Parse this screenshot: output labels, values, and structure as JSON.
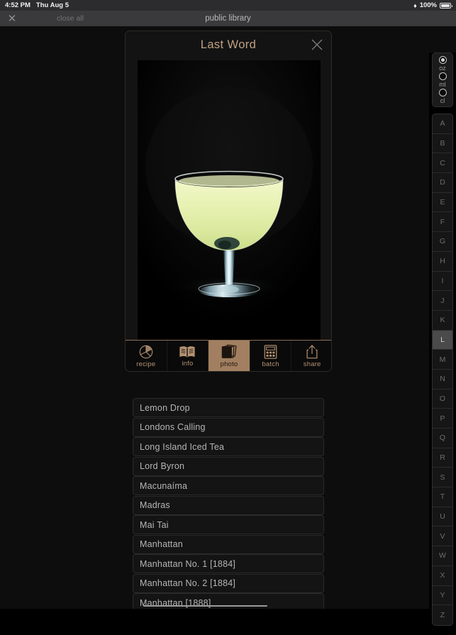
{
  "status_bar": {
    "time": "4:52 PM",
    "date": "Thu Aug 5",
    "wifi_icon": "wifi-icon",
    "battery_percent": "100%",
    "battery_icon": "battery-full-icon"
  },
  "browser_bar": {
    "close_icon": "close-x-icon",
    "close_all_label": "close all",
    "title": "public library"
  },
  "card": {
    "title": "Last Word",
    "close_icon": "close-x-icon",
    "photo": {
      "subject": "coupe cocktail glass",
      "drink_color": "#e4efb0",
      "background_color": "#000000"
    },
    "tabs": [
      {
        "label": "recipe",
        "icon": "pie-chart-icon",
        "active": false
      },
      {
        "label": "info",
        "icon": "open-book-icon",
        "active": false
      },
      {
        "label": "photo",
        "icon": "photo-stack-icon",
        "active": true
      },
      {
        "label": "batch",
        "icon": "calculator-icon",
        "active": false
      },
      {
        "label": "share",
        "icon": "share-upload-icon",
        "active": false
      }
    ],
    "accent_color": "#a17f60"
  },
  "list": {
    "items": [
      "Lemon Drop",
      "Londons Calling",
      "Long Island Iced Tea",
      "Lord Byron",
      "Macunaíma",
      "Madras",
      "Mai Tai",
      "Manhattan",
      "Manhattan No. 1 [1884]",
      "Manhattan No. 2 [1884]",
      "Manhattan [1888]"
    ]
  },
  "index_rail": {
    "units": [
      {
        "label": "oz",
        "selected": true
      },
      {
        "label": "ml",
        "selected": false
      },
      {
        "label": "cl",
        "selected": false
      }
    ],
    "letters": [
      "A",
      "B",
      "C",
      "D",
      "E",
      "F",
      "G",
      "H",
      "I",
      "J",
      "K",
      "L",
      "M",
      "N",
      "O",
      "P",
      "Q",
      "R",
      "S",
      "T",
      "U",
      "V",
      "W",
      "X",
      "Y",
      "Z"
    ],
    "active_letter": "L"
  }
}
